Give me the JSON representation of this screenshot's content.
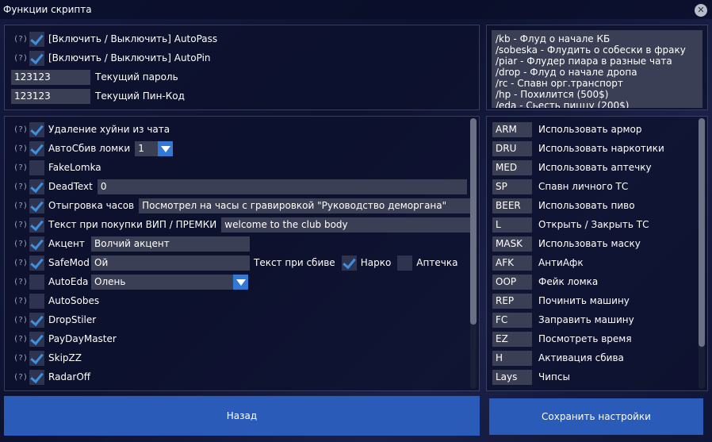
{
  "window": {
    "title": "Функции скрипта",
    "close_icon": "close-icon"
  },
  "top_panel": {
    "autopass": {
      "label": "[Включить / Выключить] AutoPass",
      "checked": true,
      "help": "(?)"
    },
    "autopin": {
      "label": "[Включить / Выключить] AutoPin",
      "checked": true,
      "help": "(?)"
    },
    "password": {
      "value": "123123",
      "label": "Текущий пароль"
    },
    "pincode": {
      "value": "123123",
      "label": "Текущий Пин-Код"
    }
  },
  "commands_text": "/kb - Флуд о начале КБ\n/sobeska - Флудить о собески в фраку\n/piar - Флудер пиара в разные чата\n/drop - Флуд о начале дропа\n/rc - Спавн орг.транспорт\n/hp - Похилится (500$)\n/eda - Сьесть пиццу (200$)",
  "features": [
    {
      "label": "Удаление хуйни из чата",
      "checked": true
    },
    {
      "label": "АвтоСбив ломки",
      "checked": true,
      "combo_value": "1"
    },
    {
      "label": "FakeLomka",
      "checked": false
    },
    {
      "label": "DeadText",
      "checked": true,
      "input_value": "0"
    },
    {
      "label": "Отыгровка часов",
      "checked": true,
      "input_value": "Посмотрел на часы с гравировкой \"Руководство деморгана\""
    },
    {
      "label": "Текст при покупки ВИП / ПРЕМКИ",
      "checked": true,
      "input_value": "welcome to the club body"
    },
    {
      "label": "Акцент",
      "checked": true,
      "input_value": "Волчий акцент"
    },
    {
      "label": "SafeMod",
      "checked": true,
      "input_value": "Ой",
      "extra_label": "Текст при сбиве",
      "narko_label": "Нарко",
      "narko_checked": true,
      "aptechka_label": "Аптечка",
      "aptechka_checked": false
    },
    {
      "label": "AutoEda",
      "checked": false,
      "combo_value": "Олень"
    },
    {
      "label": "AutoSobes",
      "checked": false
    },
    {
      "label": "DropStiler",
      "checked": true
    },
    {
      "label": "PayDayMaster",
      "checked": true
    },
    {
      "label": "SkipZZ",
      "checked": true
    },
    {
      "label": "RadarOff",
      "checked": true
    }
  ],
  "help_marker": "(?)",
  "binds": [
    {
      "key": "ARM",
      "label": "Использовать армор"
    },
    {
      "key": "DRU",
      "label": "Использовать наркотики"
    },
    {
      "key": "MED",
      "label": "Использовать аптечку"
    },
    {
      "key": "SP",
      "label": "Спавн личного ТС"
    },
    {
      "key": "BEER",
      "label": "Использовать пиво"
    },
    {
      "key": "L",
      "label": "Открыть / Закрыть ТС"
    },
    {
      "key": "MASK",
      "label": "Использовать маску"
    },
    {
      "key": "AFK",
      "label": "АнтиАфк"
    },
    {
      "key": "OOP",
      "label": "Фейк ломка"
    },
    {
      "key": "REP",
      "label": "Починить машину"
    },
    {
      "key": "FC",
      "label": "Заправить машину"
    },
    {
      "key": "EZ",
      "label": "Посмотреть время"
    },
    {
      "key": "H",
      "label": "Активация сбива"
    },
    {
      "key": "Lays",
      "label": "Чипсы"
    }
  ],
  "buttons": {
    "back": "Назад",
    "save": "Сохранить настройки"
  },
  "colors": {
    "accent": "#3d8fe0",
    "button": "#2a5bb8",
    "input_bg": "#3a3f55"
  }
}
